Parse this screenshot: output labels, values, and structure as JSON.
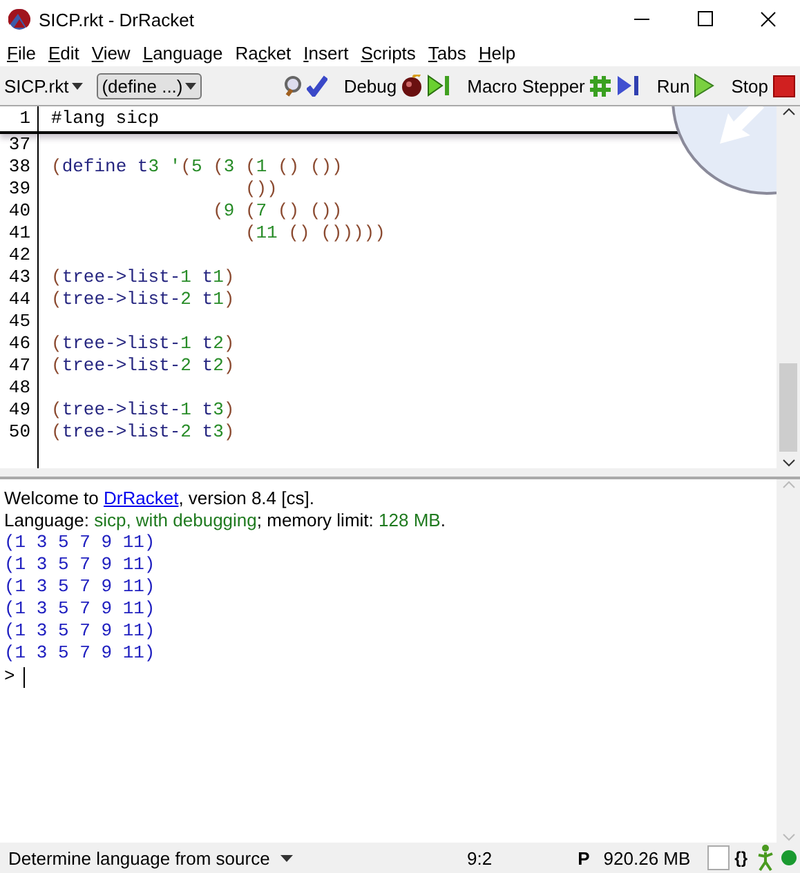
{
  "window": {
    "title": "SICP.rkt - DrRacket"
  },
  "menu": [
    {
      "parts": [
        {
          "text": "F",
          "underlined": true
        },
        {
          "text": "ile",
          "underlined": false
        }
      ]
    },
    {
      "parts": [
        {
          "text": "E",
          "underlined": true
        },
        {
          "text": "dit",
          "underlined": false
        }
      ]
    },
    {
      "parts": [
        {
          "text": "V",
          "underlined": true
        },
        {
          "text": "iew",
          "underlined": false
        }
      ]
    },
    {
      "parts": [
        {
          "text": "L",
          "underlined": true
        },
        {
          "text": "anguage",
          "underlined": false
        }
      ]
    },
    {
      "parts": [
        {
          "text": "Ra",
          "underlined": false
        },
        {
          "text": "c",
          "underlined": true
        },
        {
          "text": "ket",
          "underlined": false
        }
      ]
    },
    {
      "parts": [
        {
          "text": "I",
          "underlined": true
        },
        {
          "text": "nsert",
          "underlined": false
        }
      ]
    },
    {
      "parts": [
        {
          "text": "S",
          "underlined": true
        },
        {
          "text": "cripts",
          "underlined": false
        }
      ]
    },
    {
      "parts": [
        {
          "text": "T",
          "underlined": true
        },
        {
          "text": "abs",
          "underlined": false
        }
      ]
    },
    {
      "parts": [
        {
          "text": "H",
          "underlined": true
        },
        {
          "text": "elp",
          "underlined": false
        }
      ]
    }
  ],
  "toolbar": {
    "file_menu": "SICP.rkt",
    "definitions_menu": "(define ...)",
    "buttons": [
      {
        "kind": "check-syntax"
      },
      {
        "kind": "debug",
        "label": "Debug"
      },
      {
        "kind": "macro-stepper",
        "label": "Macro Stepper"
      },
      {
        "kind": "run",
        "label": "Run"
      },
      {
        "kind": "stop",
        "label": "Stop"
      }
    ]
  },
  "editor": {
    "header_line": {
      "number": "1",
      "code": "#lang sicp"
    },
    "lines": [
      {
        "number": "37"
      },
      {
        "number": "38",
        "code": "(define t3 '(5 (3 (1 () ())"
      },
      {
        "number": "39",
        "code": "                  ())"
      },
      {
        "number": "40",
        "code": "               (9 (7 () ())"
      },
      {
        "number": "41",
        "code": "                  (11 () ()))))"
      },
      {
        "number": "42"
      },
      {
        "number": "43",
        "code": "(tree->list-1 t1)"
      },
      {
        "number": "44",
        "code": "(tree->list-2 t1)"
      },
      {
        "number": "45"
      },
      {
        "number": "46",
        "code": "(tree->list-1 t2)"
      },
      {
        "number": "47",
        "code": "(tree->list-2 t2)"
      },
      {
        "number": "48"
      },
      {
        "number": "49",
        "code": "(tree->list-1 t3)"
      },
      {
        "number": "50",
        "code": "(tree->list-2 t3)"
      }
    ]
  },
  "interactions": {
    "welcome": [
      {
        "kind": "plain",
        "text": "Welcome to "
      },
      {
        "kind": "link",
        "text": "DrRacket"
      },
      {
        "kind": "plain",
        "text": ", version 8.4 [cs]."
      }
    ],
    "language": [
      {
        "kind": "plain",
        "text": "Language: "
      },
      {
        "kind": "value",
        "text": "sicp, with debugging"
      },
      {
        "kind": "plain",
        "text": "; memory limit: "
      },
      {
        "kind": "value",
        "text": "128 MB"
      },
      {
        "kind": "plain",
        "text": "."
      }
    ],
    "outputs": [
      "(1 3 5 7 9 11)",
      "(1 3 5 7 9 11)",
      "(1 3 5 7 9 11)",
      "(1 3 5 7 9 11)",
      "(1 3 5 7 9 11)",
      "(1 3 5 7 9 11)"
    ],
    "prompt": ">"
  },
  "status_bar": {
    "language": "Determine language from source",
    "position": "9:2",
    "mode": "P",
    "memory": "920.26 MB",
    "parens": "{}"
  }
}
